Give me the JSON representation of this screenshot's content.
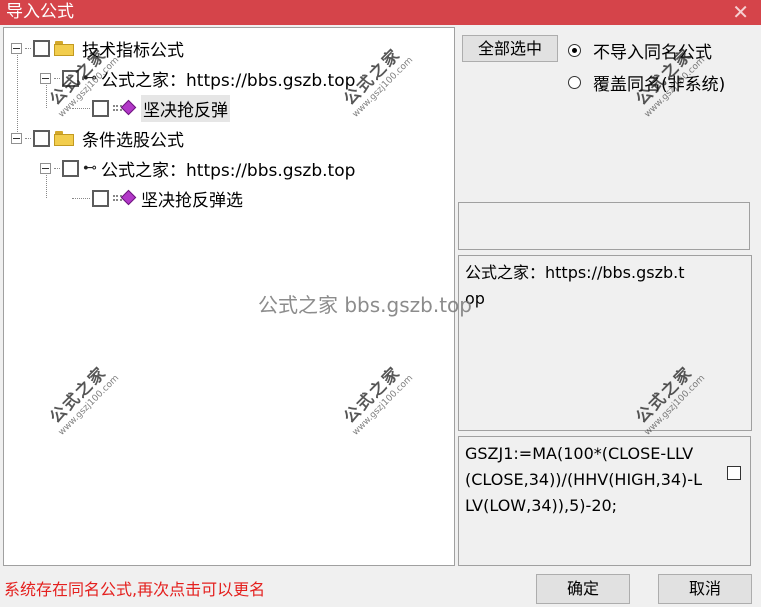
{
  "window": {
    "title": "导入公式",
    "close_glyph": "✕"
  },
  "tree": {
    "group1": {
      "label": "技术指标公式",
      "source": "公式之家：https://bbs.gszb.top",
      "item": "坚决抢反弹"
    },
    "group2": {
      "label": "条件选股公式",
      "source": "公式之家：https://bbs.gszb.top",
      "item": "坚决抢反弹选"
    },
    "icons": {
      "folder": "folder-icon",
      "key": "key-icon",
      "formula": "formula-diamond-icon",
      "key_glyph": "⊷"
    }
  },
  "controls": {
    "select_all_label": "全部选中",
    "radio_skip_label": "不导入同名公式",
    "radio_overwrite_label": "覆盖同名(非系统)",
    "radio_selected": "skip"
  },
  "panels": {
    "info_text": "公式之家：https://bbs.gszb.top",
    "code_text": "GSZJ1:=MA(100*(CLOSE-LLV(CLOSE,34))/(HHV(HIGH,34)-LLV(LOW,34)),5)-20;"
  },
  "status": {
    "message": "系统存在同名公式,再次点击可以更名"
  },
  "buttons": {
    "ok_label": "确定",
    "cancel_label": "取消"
  },
  "watermarks": {
    "text": "公式之家",
    "url": "www.gszj100.com",
    "center_text": "公式之家 bbs.gszb.top"
  },
  "colors": {
    "titlebar": "#d5444a",
    "status_text": "#e4201e",
    "formula_icon": "#b238c8",
    "folder": "#f2cd4d"
  }
}
